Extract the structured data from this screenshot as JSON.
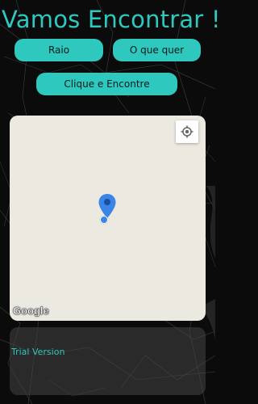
{
  "header": {
    "title": "Vamos Encontrar !"
  },
  "buttons": {
    "raio": "Raio",
    "o_que_quer": "O que quer",
    "clique_encontre": "Clique e Encontre"
  },
  "map": {
    "attribution": "Google",
    "locate_icon": "my-location-icon",
    "pin_icon": "map-pin-icon"
  },
  "footer": {
    "trial_label": "Trial Version"
  },
  "colors": {
    "accent": "#2ec8bf",
    "background": "#0b0b0b",
    "map_land": "#ece9e1",
    "pin": "#3a86e8"
  }
}
